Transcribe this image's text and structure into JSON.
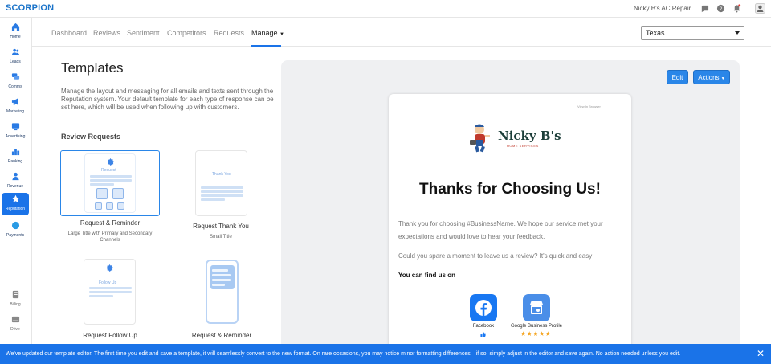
{
  "app": {
    "brand": "SCORPION",
    "account_name": "Nicky B's AC Repair"
  },
  "sidebar": {
    "items": [
      {
        "label": "Home",
        "icon": "home-icon"
      },
      {
        "label": "Leads",
        "icon": "users-icon"
      },
      {
        "label": "Comms",
        "icon": "chat-icon"
      },
      {
        "label": "Marketing",
        "icon": "megaphone-icon"
      },
      {
        "label": "Advertising",
        "icon": "monitor-icon"
      },
      {
        "label": "Ranking",
        "icon": "ranking-icon"
      },
      {
        "label": "Revenue",
        "icon": "revenue-icon"
      },
      {
        "label": "Reputation",
        "icon": "star-icon",
        "active": true
      },
      {
        "label": "Payments",
        "icon": "payments-icon"
      }
    ],
    "bottom": [
      {
        "label": "Billing",
        "icon": "billing-icon"
      },
      {
        "label": "Drive",
        "icon": "drive-icon"
      }
    ]
  },
  "tabs": [
    "Dashboard",
    "Reviews",
    "Sentiment",
    "Competitors",
    "Requests",
    "Manage"
  ],
  "location_select": {
    "value": "Texas"
  },
  "page": {
    "title": "Templates",
    "description": "Manage the layout and messaging for all emails and texts sent through the Reputation system. Your default template for each type of response can be set here, which will be used when following up with customers.",
    "section": "Review Requests"
  },
  "templates": [
    {
      "name": "Request & Reminder",
      "sub": "Large Title with Primary and Secondary Channels",
      "thumb_label": "Request"
    },
    {
      "name": "Request Thank You",
      "sub": "Small Title",
      "thumb_label": "Thank You"
    },
    {
      "name": "Request Follow Up",
      "sub": "",
      "thumb_label": "Follow Up"
    },
    {
      "name": "Request & Reminder",
      "sub": "",
      "thumb_label": ""
    }
  ],
  "preview": {
    "edit_label": "Edit",
    "actions_label": "Actions",
    "view_in_browser": "View In Browser",
    "brand_name": "Nicky B's",
    "brand_tagline": "HOME SERVICES",
    "title": "Thanks for Choosing Us!",
    "paragraph1": "Thank you for choosing #BusinessName. We hope our service met your expectations and would love to hear your feedback.",
    "paragraph2": "Could you spare a moment to leave us a review? It's quick and easy",
    "find_us": "You can find us on",
    "channels": [
      {
        "label": "Facebook",
        "icon": "facebook-icon",
        "color": "#1877f2"
      },
      {
        "label": "Google Business Profile",
        "icon": "google-business-icon",
        "color": "#4a8ee8"
      }
    ]
  },
  "banner": {
    "text": "We've updated our template editor. The first time you edit and save a template, it will seamlessly convert to the new format. On rare occasions, you may notice minor formatting differences—if so, simply adjust in the editor and save again. No action needed unless you edit."
  },
  "colors": {
    "accent": "#1a73e8",
    "star": "#f5a623"
  }
}
